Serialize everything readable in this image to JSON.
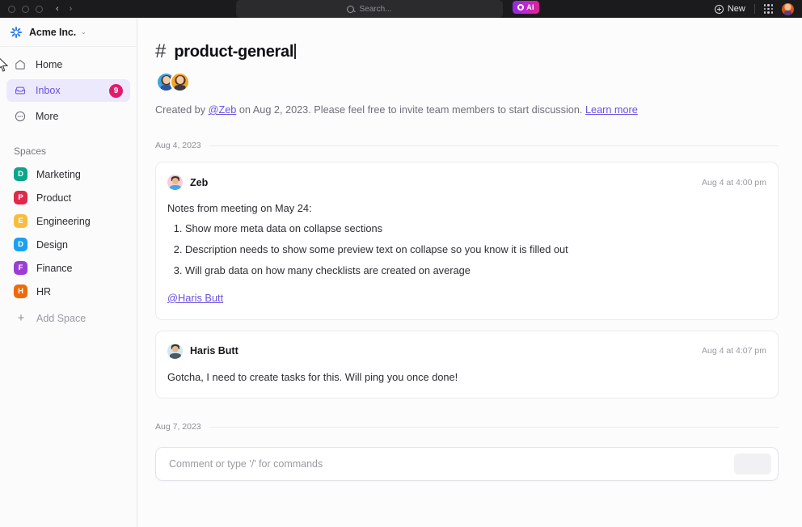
{
  "titlebar": {
    "window_controls": [
      "close",
      "minimize",
      "maximize"
    ],
    "back_arrow": "‹",
    "forward_arrow": "›",
    "search_placeholder": "Search...",
    "ai_label": "AI",
    "new_label": "New"
  },
  "sidebar": {
    "workspace": {
      "name": "Acme Inc.",
      "chevron": "⌄"
    },
    "nav": [
      {
        "label": "Home",
        "icon": "home-icon",
        "active": false,
        "badge": ""
      },
      {
        "label": "Inbox",
        "icon": "inbox-icon",
        "active": true,
        "badge": "9"
      },
      {
        "label": "More",
        "icon": "more-icon",
        "active": false,
        "badge": ""
      }
    ],
    "spaces_title": "Spaces",
    "spaces": [
      {
        "label": "Marketing",
        "initial": "D",
        "color": "#0ba689"
      },
      {
        "label": "Product",
        "initial": "P",
        "color": "#e0294a"
      },
      {
        "label": "Engineering",
        "initial": "E",
        "color": "#f9bd3e"
      },
      {
        "label": "Design",
        "initial": "D",
        "color": "#1aa0ef"
      },
      {
        "label": "Finance",
        "initial": "F",
        "color": "#9b3ed4"
      },
      {
        "label": "HR",
        "initial": "H",
        "color": "#f06a0a"
      }
    ],
    "add_space": {
      "label": "Add Space",
      "plus": "+"
    }
  },
  "main": {
    "hash": "#",
    "channel_name": "product-general",
    "members": [
      {
        "name": "member-1"
      },
      {
        "name": "member-2"
      }
    ],
    "created_prefix": "Created by ",
    "created_mention": "@Zeb",
    "created_middle": " on Aug 2, 2023. Please feel free to invite team members to start discussion. ",
    "created_link": "Learn more",
    "date_dividers": {
      "first": "Aug 4, 2023",
      "second": "Aug 7, 2023"
    },
    "messages": [
      {
        "author": "Zeb",
        "avatar": "zeb",
        "time": "Aug 4 at 4:00 pm",
        "intro": "Notes from meeting on May 24:",
        "items": [
          "Show more meta data on collapse sections",
          "Description needs to show some preview text on collapse so you know it is filled out",
          "Will grab data on how many checklists are created on average"
        ],
        "mention": "@Haris Butt"
      },
      {
        "author": "Haris Butt",
        "avatar": "haris",
        "time": "Aug 4 at 4:07 pm",
        "intro": "Gotcha, I need to create tasks for this. Will ping you once done!",
        "items": [],
        "mention": ""
      }
    ],
    "composer": {
      "placeholder": "Comment or type '/' for commands",
      "send_label": ""
    }
  },
  "colors": {
    "accent": "#6b50e0",
    "badge": "#e31b6d",
    "active_bg": "#ece9fd"
  }
}
